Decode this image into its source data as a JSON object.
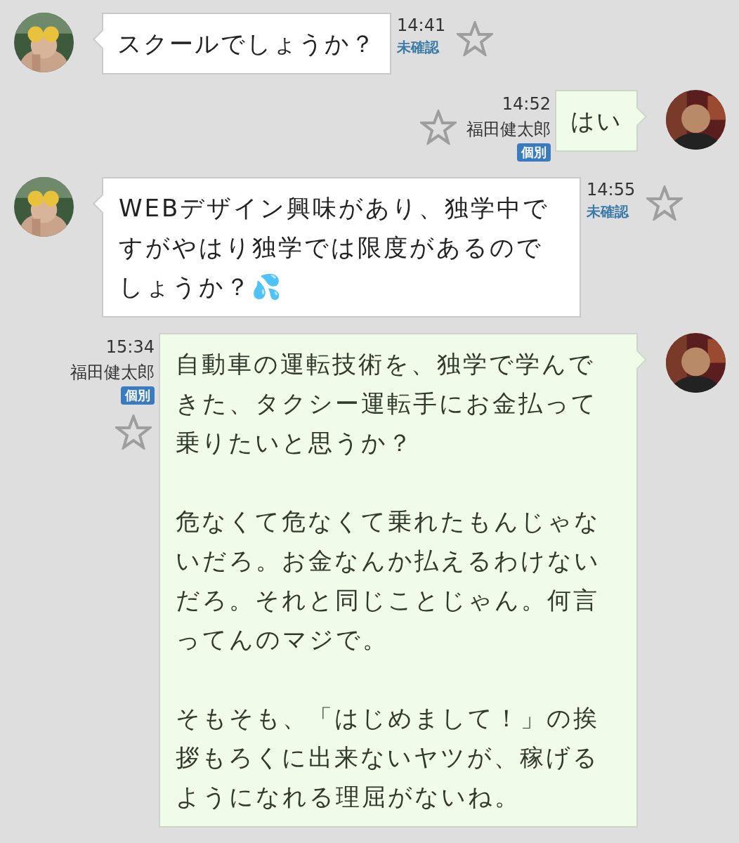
{
  "messages": [
    {
      "kind": "incoming",
      "paragraphs": [
        "スクールでしょうか？"
      ],
      "time": "14:41",
      "status": "未確認",
      "starred": false
    },
    {
      "kind": "outgoing",
      "paragraphs": [
        "はい"
      ],
      "time": "14:52",
      "sender": "福田健太郎",
      "badge": "個別",
      "starred": false
    },
    {
      "kind": "incoming",
      "paragraphs": [
        "WEBデザイン興味があり、独学中ですがやはり独学では限度があるのでしょうか？💦"
      ],
      "time": "14:55",
      "status": "未確認",
      "starred": false
    },
    {
      "kind": "outgoing",
      "paragraphs": [
        "自動車の運転技術を、独学で学んできた、タクシー運転手にお金払って乗りたいと思うか？",
        "危なくて危なくて乗れたもんじゃないだろ。お金なんか払えるわけないだろ。それと同じことじゃん。何言ってんのマジで。",
        "そもそも、「はじめまして！」の挨拶もろくに出来ないヤツが、稼げるようになれる理屈がないね。"
      ],
      "time": "15:34",
      "sender": "福田健太郎",
      "badge": "個別",
      "starred": false
    }
  ]
}
